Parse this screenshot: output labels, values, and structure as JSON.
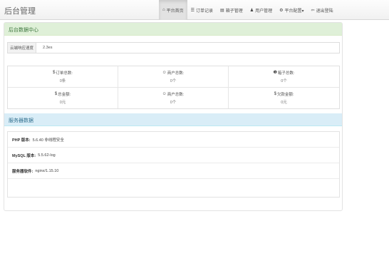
{
  "brand": "后台管理",
  "nav": [
    {
      "icon": "home-icon",
      "glyph": "⌂",
      "label": "平台首页",
      "active": true
    },
    {
      "icon": "list-icon",
      "glyph": "☰",
      "label": "订单记录",
      "active": false
    },
    {
      "icon": "file-icon",
      "glyph": "▤",
      "label": "箱子管理",
      "active": false
    },
    {
      "icon": "user-icon",
      "glyph": "♟",
      "label": "用户管理",
      "active": false
    },
    {
      "icon": "gear-icon",
      "glyph": "⚙",
      "label": "平台配置▾",
      "active": false
    },
    {
      "icon": "logout-icon",
      "glyph": "⇦",
      "label": "退出登陆",
      "active": false
    }
  ],
  "panel1": {
    "title": "后台数据中心",
    "speed_label": "云端响应速度",
    "speed_value": "2.3es"
  },
  "stats": [
    {
      "icon": "dollar-icon",
      "glyph": "$",
      "label": "订单总数:",
      "value": "0条"
    },
    {
      "icon": "users-icon",
      "glyph": "☺",
      "label": "商户总数:",
      "value": "0个"
    },
    {
      "icon": "info-icon",
      "glyph": "❶",
      "label": "箱子总数:",
      "value": "0个"
    },
    {
      "icon": "dollar-icon",
      "glyph": "$",
      "label": "总金额:",
      "value": "0元"
    },
    {
      "icon": "users-icon",
      "glyph": "☺",
      "label": "商户总数:",
      "value": "0个"
    },
    {
      "icon": "dollar-icon",
      "glyph": "$",
      "label": "欠款金额:",
      "value": "0元"
    }
  ],
  "panel2": {
    "title": "服务器数据",
    "rows": [
      {
        "key": "PHP 版本:",
        "value": "5.6.40 非线程安全"
      },
      {
        "key": "MySQL 版本:",
        "value": "5.5.62-log"
      },
      {
        "key": "服务器软件:",
        "value": "nginx/1.15.10"
      },
      {
        "key": "",
        "value": ""
      }
    ]
  }
}
